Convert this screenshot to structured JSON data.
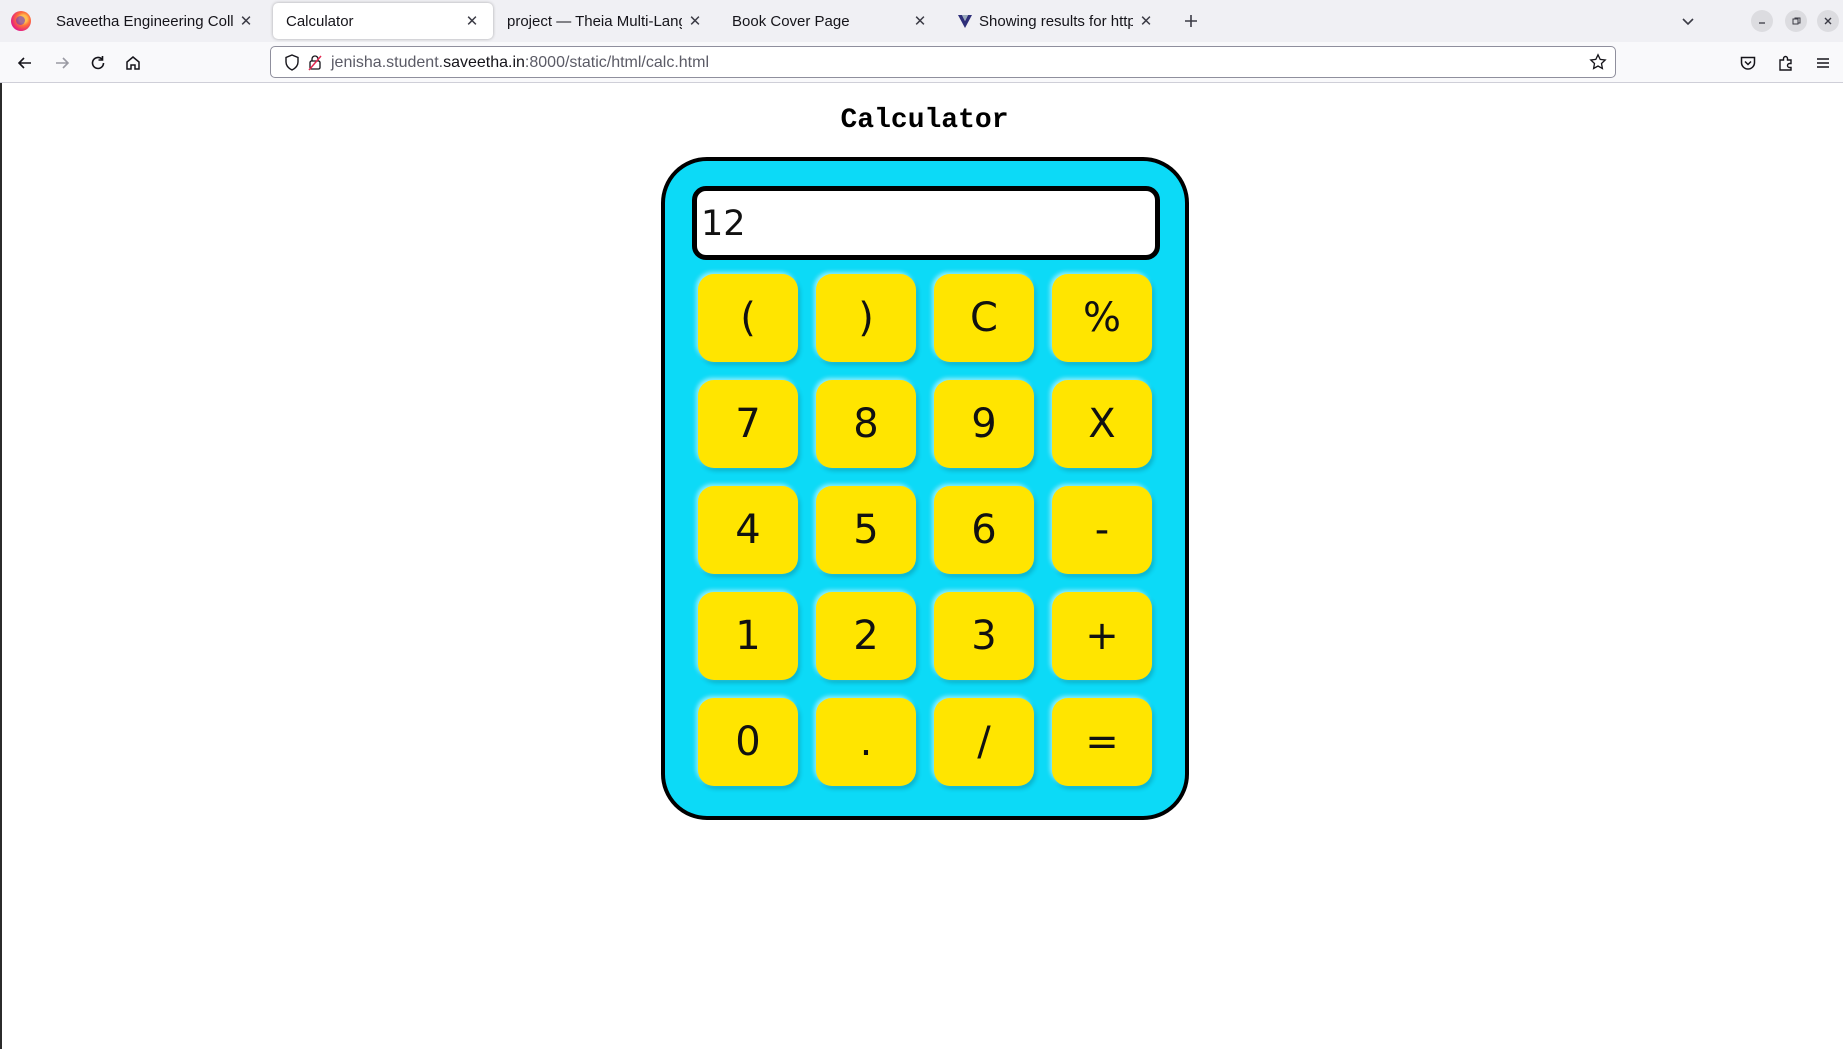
{
  "browser": {
    "tabs": [
      {
        "title": "Saveetha Engineering Colleg",
        "active": false
      },
      {
        "title": "Calculator",
        "active": true
      },
      {
        "title": "project — Theia Multi-Langu",
        "active": false
      },
      {
        "title": "Book Cover Page",
        "active": false
      },
      {
        "title": "Showing results for http",
        "active": false
      }
    ],
    "url": {
      "prefix": "jenisha.student.",
      "domain": "saveetha.in",
      "suffix": ":8000/static/html/calc.html"
    }
  },
  "page": {
    "title": "Calculator",
    "display_value": "12",
    "keys": [
      "(",
      ")",
      "C",
      "%",
      "7",
      "8",
      "9",
      "X",
      "4",
      "5",
      "6",
      "-",
      "1",
      "2",
      "3",
      "+",
      "0",
      ".",
      "/",
      "="
    ]
  },
  "colors": {
    "calculator_body": "#0cdaf7",
    "key_fill": "#ffe500",
    "border": "#000000"
  },
  "icons": [
    "firefox-logo-icon",
    "tab-close-icon",
    "new-tab-icon",
    "tab-list-icon",
    "minimize-icon",
    "restore-icon",
    "close-window-icon",
    "back-icon",
    "forward-icon",
    "reload-icon",
    "home-icon",
    "shield-icon",
    "insecure-lock-icon",
    "bookmark-star-icon",
    "pocket-icon",
    "extensions-icon",
    "menu-icon"
  ]
}
